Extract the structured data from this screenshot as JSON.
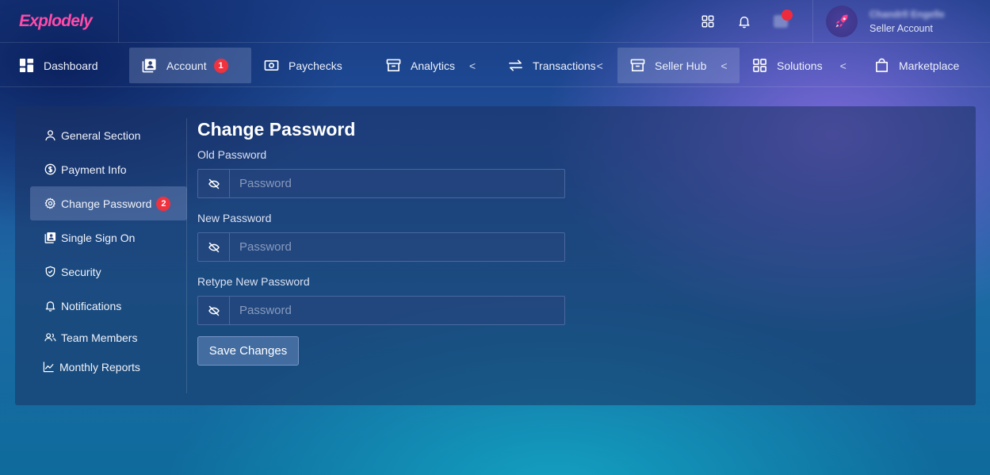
{
  "brand": {
    "logo_text": "Explodely",
    "accent_color": "#ff4ba8"
  },
  "topbar": {
    "icons": [
      "apps-grid-icon",
      "bell-icon",
      "mail-icon"
    ],
    "user": {
      "name": "Chandrll Engelle",
      "role": "Seller Account"
    }
  },
  "nav": {
    "items": [
      {
        "label": "Dashboard",
        "icon": "dashboard-icon"
      },
      {
        "label": "Account",
        "icon": "account-icon",
        "badge": "1",
        "active": true
      },
      {
        "label": "Paychecks",
        "icon": "paycheck-icon"
      },
      {
        "label": "Analytics",
        "icon": "archive-icon",
        "chevron": "<"
      },
      {
        "label": "Transactions",
        "icon": "transfer-icon",
        "chevron": "<"
      },
      {
        "label": "Seller Hub",
        "icon": "archive-icon",
        "chevron": "<",
        "active": true
      },
      {
        "label": "Solutions",
        "icon": "grid-icon",
        "chevron": "<"
      },
      {
        "label": "Marketplace",
        "icon": "shopping-bag-icon"
      }
    ]
  },
  "side_menu": {
    "items": [
      {
        "label": "General Section",
        "icon": "user-icon"
      },
      {
        "label": "Payment Info",
        "icon": "dollar-circle-icon"
      },
      {
        "label": "Change Password",
        "icon": "gear-icon",
        "badge": "2",
        "active": true
      },
      {
        "label": "Single Sign On",
        "icon": "account-card-icon"
      },
      {
        "label": "Security",
        "icon": "shield-check-icon"
      },
      {
        "label": "Notifications",
        "icon": "bell-icon"
      },
      {
        "label": "Team Members",
        "icon": "users-icon"
      },
      {
        "label": "Monthly Reports",
        "icon": "chart-line-icon"
      }
    ]
  },
  "form": {
    "title": "Change Password",
    "fields": [
      {
        "label": "Old Password",
        "placeholder": "Password",
        "value": ""
      },
      {
        "label": "New Password",
        "placeholder": "Password",
        "value": ""
      },
      {
        "label": "Retype New Password",
        "placeholder": "Password",
        "value": ""
      }
    ],
    "save_label": "Save Changes"
  },
  "colors": {
    "badge_red": "#f0323f"
  }
}
